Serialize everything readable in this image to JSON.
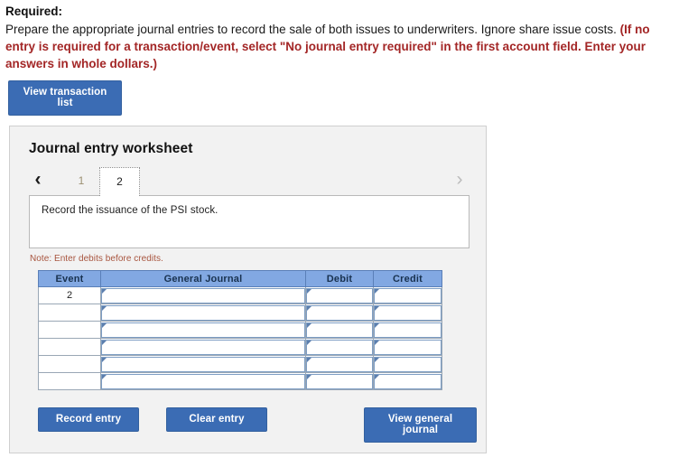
{
  "instructions": {
    "required_label": "Required:",
    "line1": "Prepare the appropriate journal entries to record the sale of both issues to underwriters. Ignore share issue costs. ",
    "red_text": "(If no entry is required for a transaction/event, select \"No journal entry required\" in the first account field. Enter your answers in whole dollars.)",
    "red_color": "#a32626"
  },
  "toolbar": {
    "view_transaction_list_label": "View transaction list"
  },
  "worksheet": {
    "title": "Journal entry worksheet",
    "prev_icon": "chevron-left-icon",
    "next_icon": "chevron-right-icon",
    "prev_glyph": "‹",
    "next_glyph": "›",
    "tabs": [
      {
        "label": "1",
        "active": false
      },
      {
        "label": "2",
        "active": true
      }
    ],
    "description": "Record the issuance of the PSI stock.",
    "note": "Note: Enter debits before credits.",
    "accent_color": "#3b6cb4",
    "header_color": "#82a8e2"
  },
  "table": {
    "columns": [
      "Event",
      "General Journal",
      "Debit",
      "Credit"
    ],
    "rows": [
      {
        "event": "2",
        "general_journal": "",
        "debit": "",
        "credit": ""
      },
      {
        "event": "",
        "general_journal": "",
        "debit": "",
        "credit": ""
      },
      {
        "event": "",
        "general_journal": "",
        "debit": "",
        "credit": ""
      },
      {
        "event": "",
        "general_journal": "",
        "debit": "",
        "credit": ""
      },
      {
        "event": "",
        "general_journal": "",
        "debit": "",
        "credit": ""
      },
      {
        "event": "",
        "general_journal": "",
        "debit": "",
        "credit": ""
      }
    ]
  },
  "footer": {
    "record_entry_label": "Record entry",
    "clear_entry_label": "Clear entry",
    "view_general_journal_label": "View general journal"
  }
}
